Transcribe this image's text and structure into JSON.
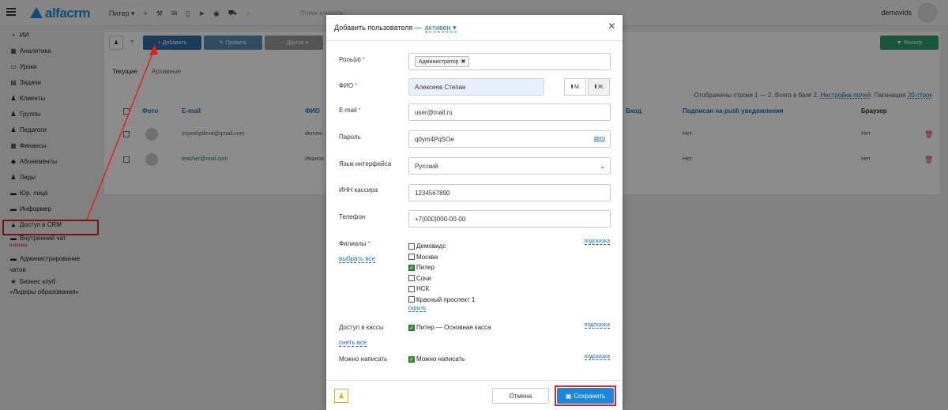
{
  "topbar": {
    "logo": "alfacrm",
    "city": "Питер ▾",
    "search_placeholder": "Поиск клиента",
    "user_name": "demovids"
  },
  "sidebar": {
    "items": [
      {
        "icon": "•",
        "label": "ИИ"
      },
      {
        "icon": "▦",
        "label": "Аналитика"
      },
      {
        "icon": "▭",
        "label": "Уроки"
      },
      {
        "icon": "▤",
        "label": "Задачи"
      },
      {
        "icon": "♟",
        "label": "Клиенты"
      },
      {
        "icon": "♟",
        "label": "Группы"
      },
      {
        "icon": "♟",
        "label": "Педагоги"
      },
      {
        "icon": "▦",
        "label": "Финансы"
      },
      {
        "icon": "◆",
        "label": "Абонементы"
      },
      {
        "icon": "♟",
        "label": "Лиды"
      },
      {
        "icon": "▬",
        "label": "Юр. лица"
      },
      {
        "icon": "▬",
        "label": "Информер"
      },
      {
        "icon": "▲",
        "label": "Доступ в CRM"
      },
      {
        "icon": "▬",
        "label": "Внутренний чат"
      },
      {
        "icon": "▬",
        "label": "Администрирование"
      },
      {
        "icon": "★",
        "label": "Бизнес клуб"
      }
    ],
    "chat_badge": "новинка",
    "admin_line2": "чатов",
    "club_line2": "«Лидеры образования»"
  },
  "toolbar": {
    "add": "+ Добавить",
    "edit": "✎ Править",
    "other": "⋯ Другое ▾",
    "filter": "▼ Фильтр"
  },
  "tabs": [
    "Текущие",
    "Архивные"
  ],
  "stats": {
    "text": "Отображены строки 1 — 2. Всего в базе 2.",
    "fields_link": "Настройка полей",
    "pagination_label": "Пагинация",
    "pagination_link": "20 строк"
  },
  "table": {
    "headers": [
      "Фото",
      "E-mail",
      "ФИО",
      "Вход",
      "Подписан на push уведомления",
      "Браузер"
    ],
    "rows": [
      {
        "email": "zoyeshpileva@gmail.com",
        "name": "demovi",
        "push": "Нет",
        "browser": "Нет"
      },
      {
        "email": "teacher@mail.com",
        "name": "Иванов",
        "push": "Нет",
        "browser": "Нет"
      }
    ]
  },
  "modal": {
    "title": "Добавить пользователя  —",
    "status": "активен ▾",
    "close": "×",
    "role_label": "Роль(и)",
    "role_tag": "Администратор",
    "name_label": "ФИО",
    "name_value": "Алексеев Степан",
    "gender_m": "М.",
    "gender_f": "Ж.",
    "email_label": "E-mail",
    "email_value": "user@mail.ru",
    "password_label": "Пароль",
    "password_value": "q0ym4PqSOe",
    "password_auto": "авто",
    "lang_label": "Язык интерфейса",
    "lang_value": "Русский",
    "inn_label": "ИНН кассира",
    "inn_value": "1234567890",
    "phone_label": "Телефон",
    "phone_placeholder": "+7(000)000-00-00",
    "branches_label": "Филиалы",
    "branches_select_all": "выбрать все",
    "branches_hint": "подсказка",
    "branches": [
      {
        "label": "Демовидс",
        "checked": false
      },
      {
        "label": "Москва",
        "checked": false
      },
      {
        "label": "Питер",
        "checked": true
      },
      {
        "label": "Сочи",
        "checked": false
      },
      {
        "label": "НСК",
        "checked": false
      },
      {
        "label": "Красный проспект 1",
        "checked": false
      }
    ],
    "branches_hide": "скрыть",
    "cash_label": "Доступ в кассы",
    "cash_unselect": "снять все",
    "cash_item": "Питер — Основная касса",
    "cash_hint": "подсказка",
    "write_label": "Можно написать",
    "write_item": "Можно написать",
    "write_hint": "подсказка",
    "cancel": "Отмена",
    "save": "Сохранить"
  },
  "colors": {
    "accent": "#1c86d8",
    "toolbar_blue": "#2d6da3",
    "filter_green": "#2e9f6a",
    "annotation_red": "#e02020"
  }
}
